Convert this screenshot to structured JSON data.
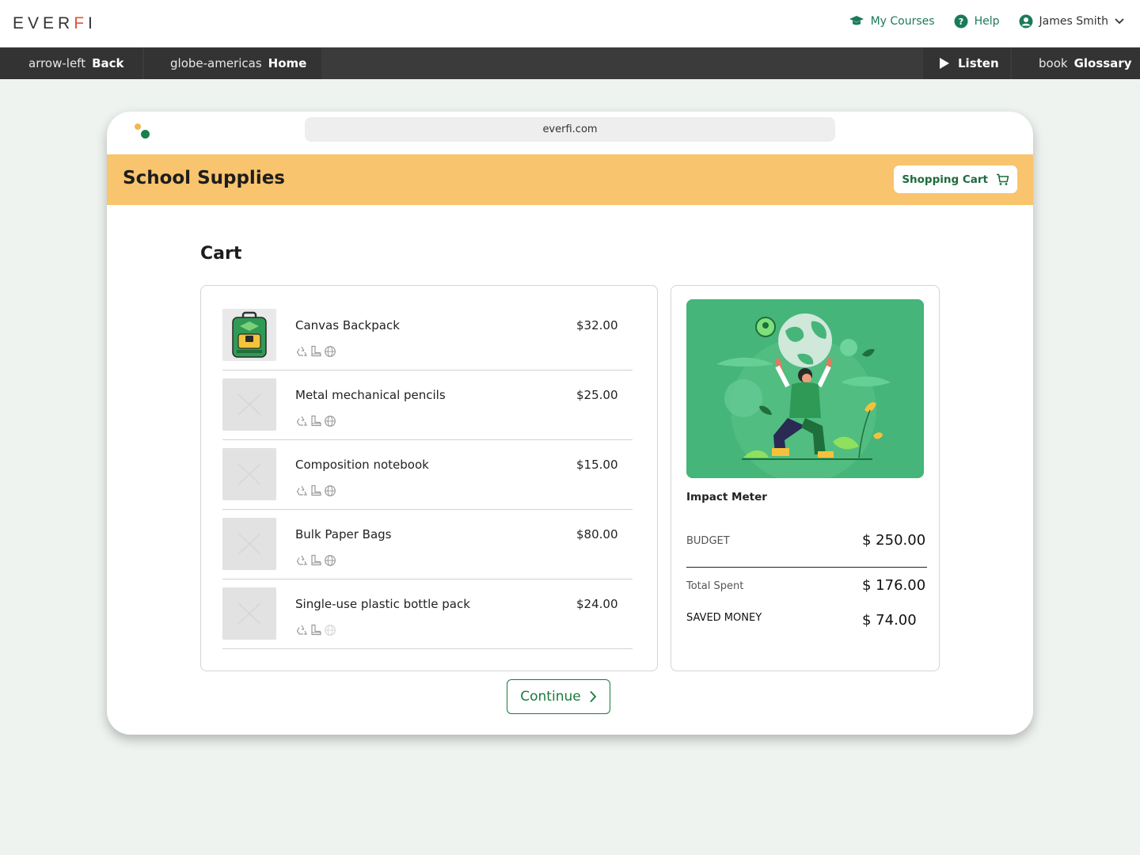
{
  "brand": {
    "logo_text_a": "EVER",
    "logo_text_b": "F",
    "logo_text_c": "I"
  },
  "topnav": {
    "my_courses": "My Courses",
    "help": "Help",
    "user_name": "James Smith"
  },
  "subbar": {
    "back_prefix": "arrow-left",
    "back_label": "Back",
    "home_prefix": "globe-americas",
    "home_label": "Home",
    "listen_label": "Listen",
    "glossary_prefix": "book",
    "glossary_label": "Glossary"
  },
  "browser": {
    "url": "everfi.com"
  },
  "site": {
    "title": "School Supplies",
    "cart_button": "Shopping Cart"
  },
  "cart": {
    "heading": "Cart",
    "items": [
      {
        "name": "Canvas Backpack",
        "price": "$32.00",
        "image": "backpack"
      },
      {
        "name": "Metal mechanical pencils",
        "price": "$25.00",
        "image": "placeholder"
      },
      {
        "name": "Composition notebook",
        "price": "$15.00",
        "image": "placeholder"
      },
      {
        "name": "Bulk Paper Bags",
        "price": "$80.00",
        "image": "placeholder"
      },
      {
        "name": "Single-use plastic bottle pack",
        "price": "$24.00",
        "image": "placeholder"
      }
    ]
  },
  "impact": {
    "title": "Impact Meter",
    "budget_label": "BUDGET",
    "budget_value": "$ 250.00",
    "spent_label": "Total Spent",
    "spent_value": "$ 176.00",
    "saved_label": "SAVED MONEY",
    "saved_value": "$ 74.00"
  },
  "continue_label": "Continue",
  "colors": {
    "accent_green": "#1b7a3e",
    "header_yellow": "#f8c46e",
    "illustration_green": "#46b57a",
    "subbar_dark": "#3b3b3b"
  },
  "icons": [
    "graduation-cap-icon",
    "help-circle-icon",
    "user-circle-icon",
    "chevron-down-icon",
    "play-icon",
    "shopping-cart-icon",
    "recycle-icon",
    "boot-icon",
    "globe-icon",
    "chevron-right-icon"
  ]
}
